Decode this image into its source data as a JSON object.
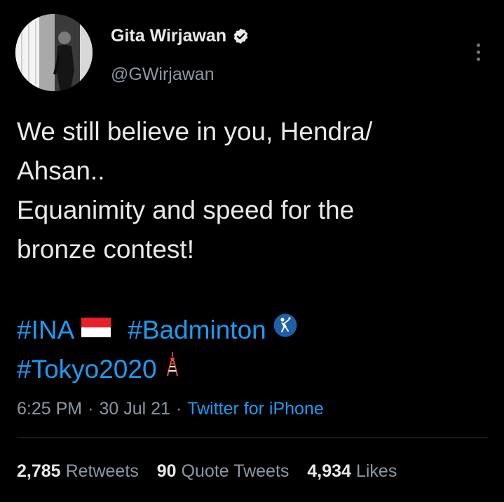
{
  "author": {
    "display_name": "Gita Wirjawan",
    "handle": "@GWirjawan",
    "verified": true,
    "avatar": "profile-photo"
  },
  "tweet": {
    "lines": [
      "We still believe in you, Hendra/",
      "Ahsan..",
      "Equanimity and speed for the",
      "bronze contest!"
    ],
    "hashtags": [
      {
        "text": "#INA",
        "emoji": "indonesia-flag-icon"
      },
      {
        "text": "#Badminton",
        "emoji": "badminton-icon"
      },
      {
        "text": "#Tokyo2020",
        "emoji": "tokyo-tower-icon"
      }
    ]
  },
  "meta": {
    "time": "6:25 PM",
    "separator": "·",
    "date": "30 Jul 21",
    "source": "Twitter for iPhone"
  },
  "stats": {
    "retweets": {
      "count": "2,785",
      "label": "Retweets"
    },
    "quotes": {
      "count": "90",
      "label": "Quote Tweets"
    },
    "likes": {
      "count": "4,934",
      "label": "Likes"
    }
  },
  "colors": {
    "background": "#000000",
    "text": "#e7e9ea",
    "secondary": "#8b98a5",
    "accent": "#1d9bf0",
    "divider": "#2f3336"
  }
}
